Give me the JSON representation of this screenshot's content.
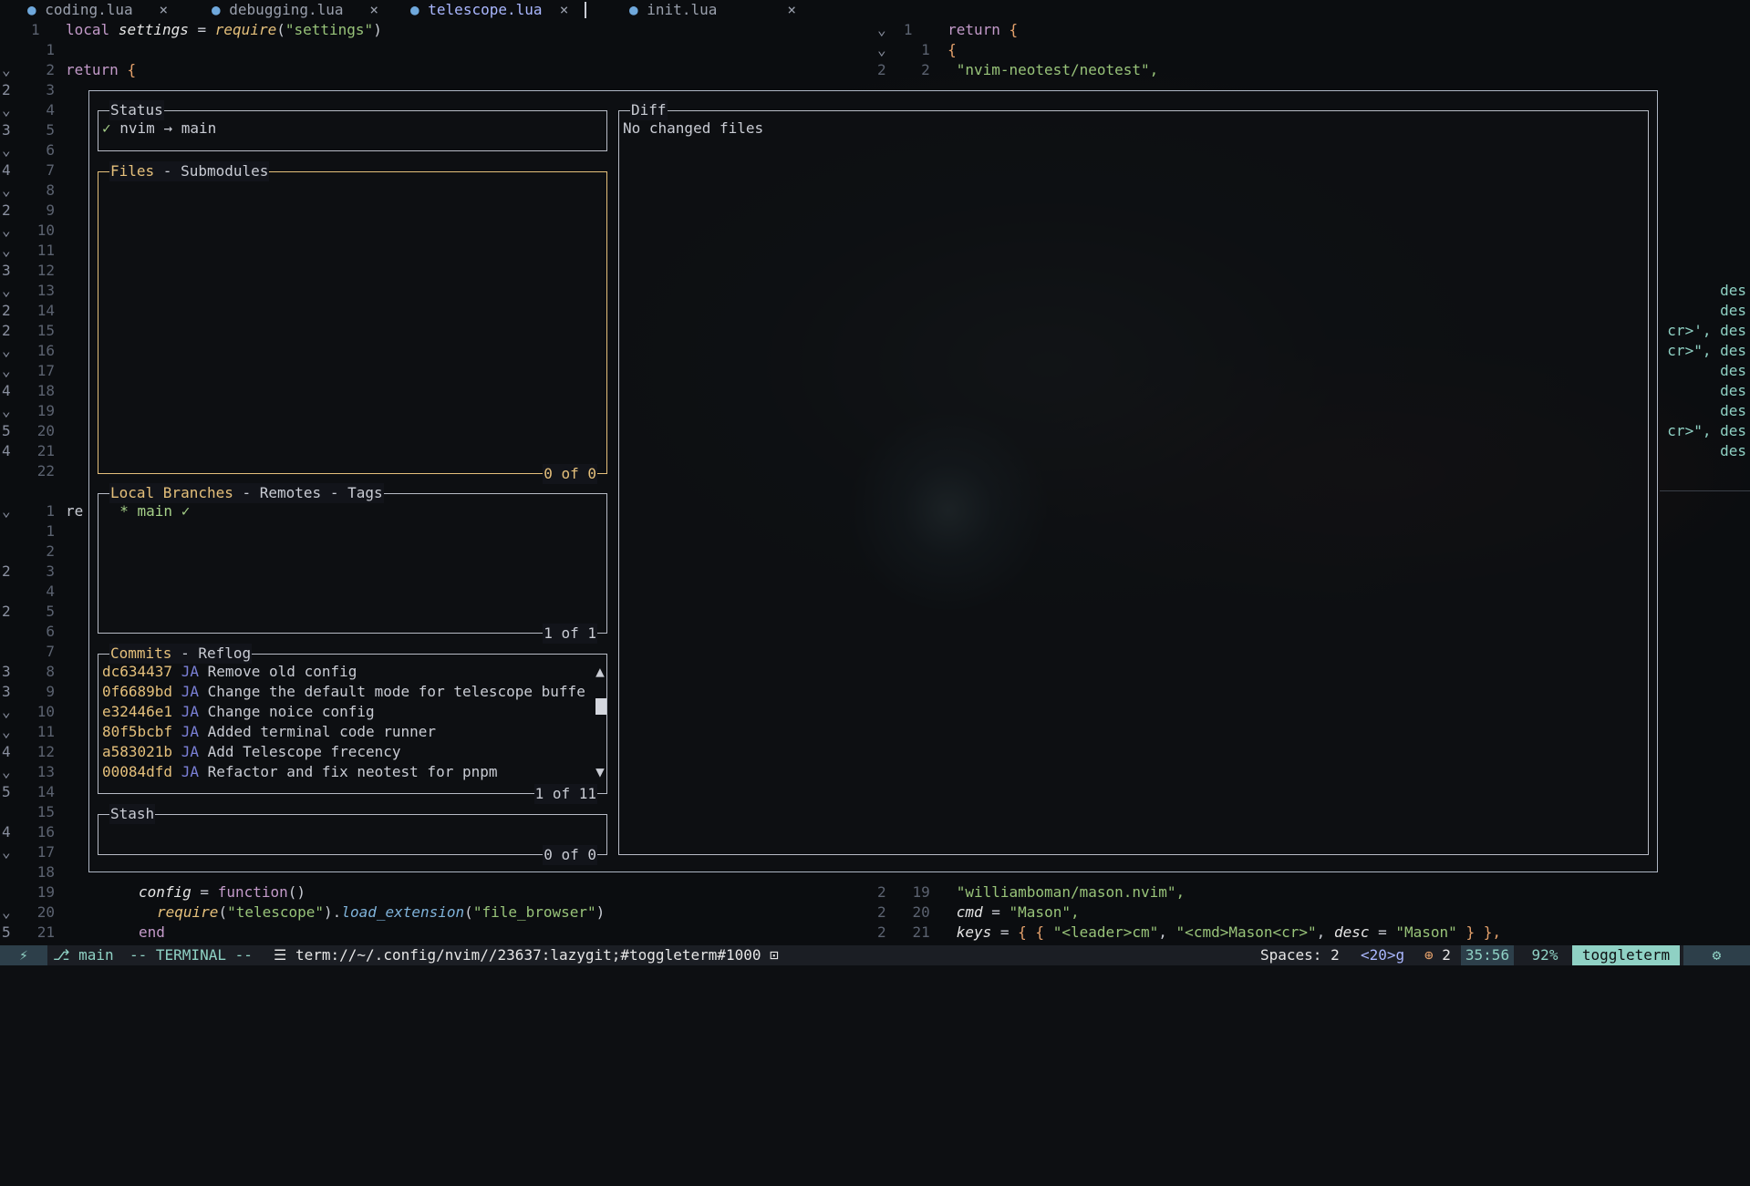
{
  "tabs": [
    {
      "label": "coding.lua",
      "close": "×"
    },
    {
      "label": "debugging.lua",
      "close": "×"
    },
    {
      "label": "telescope.lua",
      "close": "×"
    },
    {
      "label": "init.lua",
      "close": "×"
    }
  ],
  "editor_left_top": {
    "gutter": [
      "1",
      "",
      "⌄",
      "2",
      "⌄",
      "3",
      "⌄",
      "4",
      "⌄",
      "2",
      "⌄",
      "⌄",
      "3",
      "⌄",
      "2",
      "2",
      "⌄",
      "⌄",
      "4",
      "⌄",
      "5",
      "4"
    ],
    "numbers": [
      "",
      "1",
      "2",
      "3",
      "4",
      "5",
      "6",
      "7",
      "8",
      "9",
      "10",
      "11",
      "12",
      "13",
      "14",
      "15",
      "16",
      "17",
      "18",
      "19",
      "20",
      "21",
      "22"
    ],
    "line1": {
      "kw": "local",
      "var": "settings",
      "eq": " = ",
      "fn": "require",
      "open": "(",
      "str": "\"settings\"",
      "close": ")"
    },
    "line3": {
      "kw": "return",
      "brace": "{"
    }
  },
  "editor_left_bottom": {
    "gutter": [
      "⌄",
      "",
      "",
      "2",
      "",
      "2",
      "",
      "",
      "3",
      "3",
      "⌄",
      "⌄",
      "4",
      "⌄",
      "5",
      "",
      "4",
      "⌄",
      "",
      "",
      "⌄",
      "5"
    ],
    "numbers": [
      "1",
      "1",
      "2",
      "3",
      "4",
      "5",
      "6",
      "7",
      "8",
      "9",
      "10",
      "11",
      "12",
      "13",
      "14",
      "15",
      "16",
      "17",
      "18",
      "19",
      "20",
      "21"
    ],
    "first_text": "re",
    "line19": {
      "var": "config",
      "eq": " = ",
      "kw": "function",
      "paren": "()"
    },
    "line20": {
      "fn": "require",
      "a": "(",
      "str1": "\"telescope\"",
      "b": ").",
      "method": "load_extension",
      "c": "(",
      "str2": "\"file_browser\"",
      "d": ")"
    },
    "line21": {
      "kw": "end"
    }
  },
  "editor_right_top": {
    "rows": [
      {
        "g": "⌄",
        "n": "1",
        "kw": "return",
        "brace": "{"
      },
      {
        "g": "⌄",
        "n": "1",
        "brace2": "{"
      },
      {
        "g": "2",
        "n": "2",
        "str": "\"nvim-neotest/neotest\","
      }
    ],
    "right_fragments": [
      "des",
      "des",
      "cr>', des",
      "cr>\", des",
      "des",
      "des",
      "des",
      "cr>\", des",
      "des"
    ]
  },
  "editor_right_bottom": {
    "rows": [
      {
        "g": "2",
        "n": "19",
        "text": "\"williamboman/mason.nvim\","
      },
      {
        "g": "2",
        "n": "20",
        "key": "cmd",
        "eq": " = ",
        "val": "\"Mason\","
      },
      {
        "g": "2",
        "n": "21",
        "key": "keys",
        "eq": " = ",
        "rest1": "{ { ",
        "s1": "\"<leader>cm\"",
        "c1": ", ",
        "s2": "\"<cmd>Mason<cr>\"",
        "c2": ", ",
        "k2": "desc",
        "e2": " = ",
        "s3": "\"Mason\"",
        "end": " } },"
      }
    ]
  },
  "lazygit": {
    "status": {
      "title": "Status",
      "check": "✓",
      "text": "nvim → main"
    },
    "files": {
      "title_active": "Files",
      "title_rest": " - Submodules",
      "footer": "0 of 0"
    },
    "branches": {
      "title_active": "Local Branches",
      "title_rest": " - Remotes - Tags",
      "star": "* main",
      "check": "✓",
      "footer": "1 of 1"
    },
    "commits": {
      "title_active": "Commits",
      "title_rest": " - Reflog",
      "footer": "1 of 11",
      "items": [
        {
          "hash": "dc634437",
          "author": "JA",
          "msg": "Remove old config"
        },
        {
          "hash": "0f6689bd",
          "author": "JA",
          "msg": "Change the default mode for telescope buffe"
        },
        {
          "hash": "e32446e1",
          "author": "JA",
          "msg": "Change noice config"
        },
        {
          "hash": "80f5bcbf",
          "author": "JA",
          "msg": "Added terminal code runner"
        },
        {
          "hash": "a583021b",
          "author": "JA",
          "msg": "Add Telescope frecency"
        },
        {
          "hash": "00084dfd",
          "author": "JA",
          "msg": "Refactor and fix neotest for pnpm"
        }
      ],
      "scroll_up": "▲",
      "scroll_down": "▼"
    },
    "stash": {
      "title": "Stash",
      "footer": "0 of 0"
    },
    "diff": {
      "title": "Diff",
      "text": "No changed files"
    }
  },
  "statusline": {
    "mode_icon": "⚡",
    "branch": "main",
    "mode": "-- TERMINAL --",
    "path": "term://~/.config/nvim//23637:lazygit;#toggleterm#1000",
    "lock": "🔒",
    "spaces": "Spaces: 2",
    "count": "<20>g",
    "pkg": "2",
    "position": "35:56",
    "percent": "92%",
    "filetype": "toggleterm",
    "end_icon": "⚙"
  },
  "colors": {
    "accent": "#e5c07b",
    "border": "#b8bcc6",
    "hash": "#e5c07b",
    "author": "#7a7fd6",
    "green": "#a6d189"
  }
}
